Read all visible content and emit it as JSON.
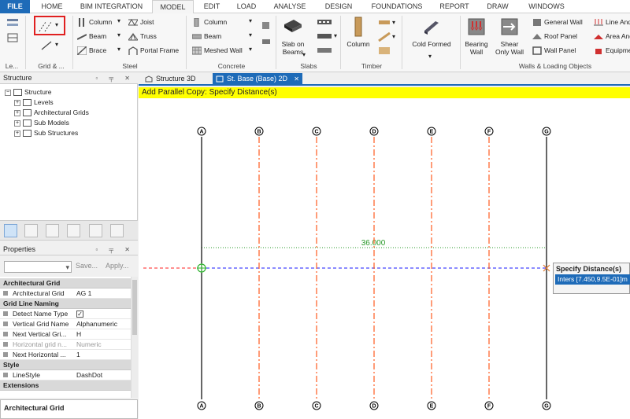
{
  "tabs": [
    {
      "label": "FILE"
    },
    {
      "label": "HOME"
    },
    {
      "label": "BIM INTEGRATION"
    },
    {
      "label": "MODEL"
    },
    {
      "label": "EDIT"
    },
    {
      "label": "LOAD"
    },
    {
      "label": "ANALYSE"
    },
    {
      "label": "DESIGN"
    },
    {
      "label": "FOUNDATIONS"
    },
    {
      "label": "REPORT"
    },
    {
      "label": "DRAW"
    },
    {
      "label": "WINDOWS"
    }
  ],
  "active_tab": "MODEL",
  "ribbon": {
    "groups": {
      "levels": "Le...",
      "grid": "Grid & ...",
      "steel": "Steel",
      "concrete": "Concrete",
      "slabs": "Slabs",
      "timber": "Timber",
      "walls": "Walls & Loading Objects"
    },
    "steel": {
      "column": "Column",
      "beam": "Beam",
      "brace": "Brace",
      "joist": "Joist",
      "truss": "Truss",
      "portal_frame": "Portal Frame"
    },
    "concrete": {
      "column": "Column",
      "beam": "Beam",
      "meshed_wall": "Meshed Wall"
    },
    "slabs": {
      "slab_on_beams_1": "Slab on",
      "slab_on_beams_2": "Beams"
    },
    "timber": {
      "column": "Column"
    },
    "cold_formed": "Cold Formed",
    "walls": {
      "bearing_1": "Bearing",
      "bearing_2": "Wall",
      "shear_1": "Shear",
      "shear_2": "Only Wall",
      "general_wall": "General Wall",
      "roof_panel": "Roof Panel",
      "wall_panel": "Wall Panel",
      "line_and": "Line And",
      "area_and": "Area And",
      "equipment": "Equipme"
    }
  },
  "structure_panel": {
    "title": "Structure",
    "tree": {
      "root": "Structure",
      "levels": "Levels",
      "arch_grids": "Architectural Grids",
      "sub_models": "Sub Models",
      "sub_structures": "Sub Structures"
    }
  },
  "properties_panel": {
    "title": "Properties",
    "save": "Save...",
    "apply": "Apply...",
    "rows": [
      {
        "type": "cat",
        "key": "Architectural Grid"
      },
      {
        "type": "row",
        "key": "Architectural Grid",
        "value": "AG 1"
      },
      {
        "type": "cat",
        "key": "Grid Line Naming"
      },
      {
        "type": "check",
        "key": "Detect Name Type",
        "value": "✓"
      },
      {
        "type": "row",
        "key": "Vertical Grid Name",
        "value": "Alphanumeric"
      },
      {
        "type": "row",
        "key": "Next Vertical Gri...",
        "value": "H"
      },
      {
        "type": "dim",
        "key": "Horizontal grid n...",
        "value": "Numeric"
      },
      {
        "type": "row",
        "key": "Next Horizontal ...",
        "value": "1"
      },
      {
        "type": "cat",
        "key": "Style"
      },
      {
        "type": "row",
        "key": "LineStyle",
        "value": "DashDot"
      },
      {
        "type": "cat",
        "key": "Extensions"
      }
    ],
    "description_title": "Architectural Grid"
  },
  "doc_tabs": [
    {
      "label": "Structure 3D",
      "active": false
    },
    {
      "label": "St. Base (Base) 2D",
      "active": true
    }
  ],
  "prompt": "Add Parallel Copy: Specify Distance(s)",
  "canvas": {
    "grid_labels": [
      "A",
      "B",
      "C",
      "D",
      "E",
      "F",
      "G"
    ],
    "dimension_text": "36.000",
    "colors": {
      "solid_grid": "#000000",
      "dashdot_grid": "#ff5a1f",
      "dimension": "#2a9a2a",
      "blue_line": "#1a1aff",
      "red_line": "#ff2020"
    }
  },
  "tooltip": {
    "title": "Specify Distance(s)",
    "input": "Inters [7.450,9.5E-01]m"
  }
}
